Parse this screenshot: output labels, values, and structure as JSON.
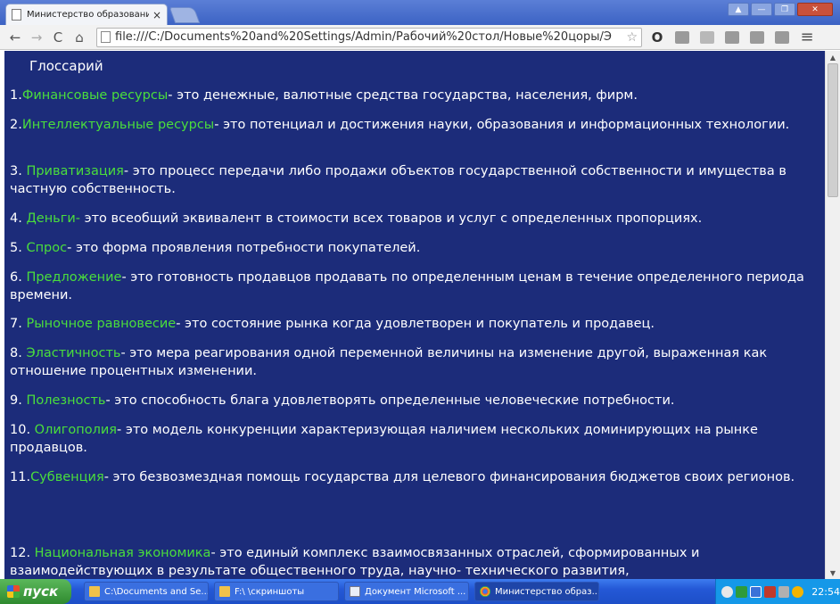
{
  "browser": {
    "tab_title": "Министерство образовани",
    "tab_close": "×",
    "url": "file:///C:/Documents%20and%20Settings/Admin/Рабочий%20стол/Новые%20цоры/Э",
    "star": "☆",
    "back": "←",
    "forward": "→",
    "reload": "C",
    "home": "⌂",
    "menu": "≡",
    "window_buttons": [
      "▲",
      "—",
      "❐",
      "✕"
    ]
  },
  "glossary": {
    "title": "Глоссарий",
    "entries": [
      {
        "num": "1.",
        "term": "Финансовые ресурсы",
        "text": "- это денежные, валютные средства государства, населения, фирм."
      },
      {
        "num": "2.",
        "term": "Интеллектуальные ресурсы",
        "text": "- это потенциал и достижения науки, образования и информационных технологии."
      },
      {
        "num": "3. ",
        "term": "Приватизация",
        "text": "- это процесс передачи либо продажи объектов государственной собственности и имущества в частную собственность."
      },
      {
        "num": "4. ",
        "term": "Деньги-",
        "text": " это всеобщий эквивалент в стоимости всех товаров и услуг с определенных пропорциях."
      },
      {
        "num": "5. ",
        "term": "Спрос",
        "text": "- это форма проявления потребности покупателей."
      },
      {
        "num": "6. ",
        "term": "Предложение",
        "text": "- это готовность продавцов продавать по определенным ценам в течение определенного периода времени."
      },
      {
        "num": "7.  ",
        "term": "Рыночное равновесие",
        "text": "- это состояние рынка когда удовлетворен и покупатель и продавец."
      },
      {
        "num": "8.  ",
        "term": "Эластичность",
        "text": "- это мера реагирования одной переменной величины на изменение другой, выраженная как отношение процентных изменении."
      },
      {
        "num": "9. ",
        "term": "Полезность",
        "text": "- это способность блага удовлетворять определенные человеческие потребности."
      },
      {
        "num": "10. ",
        "term": "Олигополия",
        "text": "- это модель конкуренции характеризующая наличием нескольких доминирующих на рынке продавцов."
      },
      {
        "num": "11.",
        "term": "Субвенция",
        "text": "- это безвозмездная помощь государства для целевого финансирования бюджетов своих регионов."
      },
      {
        "num": "12.  ",
        "term": "Национальная экономика",
        "text": "-  это единый комплекс взаимосвязанных отраслей, сформированных и взаимодействующих в результате общественного труда, научно- технического развития,"
      }
    ]
  },
  "taskbar": {
    "start_label": "пуск",
    "tasks": [
      {
        "label": "C:\\Documents and Se..."
      },
      {
        "label": "F:\\ \\скриншоты"
      },
      {
        "label": "Документ Microsoft ..."
      },
      {
        "label": "Министерство образ..."
      }
    ],
    "clock": "22:54"
  }
}
